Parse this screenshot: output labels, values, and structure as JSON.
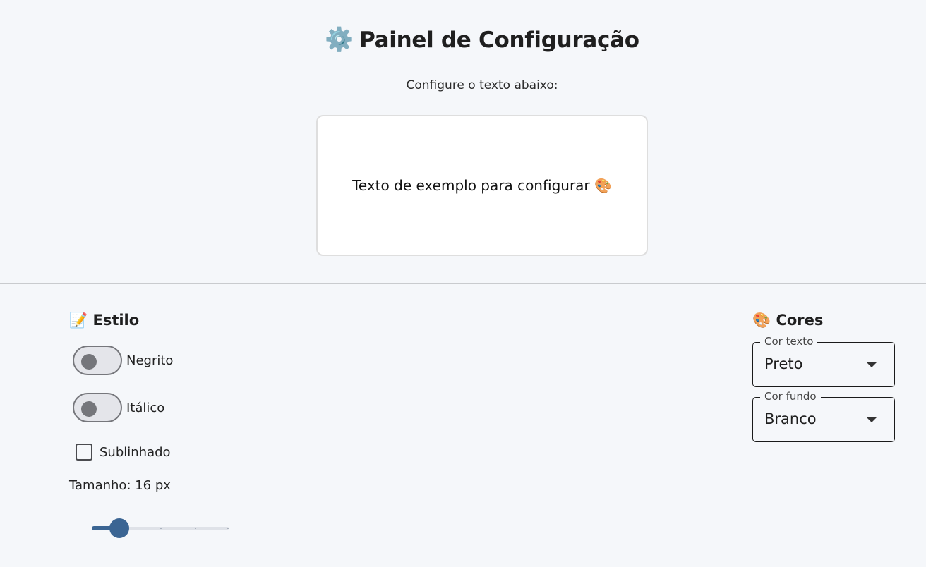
{
  "header": {
    "icon": "gear-icon",
    "icon_glyph": "⚙️",
    "title": "Painel de Configuração",
    "subtitle": "Configure o texto abaixo:"
  },
  "preview": {
    "text": "Texto de exemplo para configurar 🎨"
  },
  "style_section": {
    "icon_glyph": "📝",
    "title": "Estilo",
    "bold_label": "Negrito",
    "bold_on": false,
    "italic_label": "Itálico",
    "italic_on": false,
    "underline_label": "Sublinhado",
    "underline_checked": false,
    "size_label": "Tamanho: 16 px",
    "size_slider": {
      "min": 12,
      "max": 32,
      "value": 16,
      "step_marks": 5
    }
  },
  "colors_section": {
    "icon_glyph": "🎨",
    "title": "Cores",
    "text_color_label": "Cor texto",
    "text_color_value": "Preto",
    "bg_color_label": "Cor fundo",
    "bg_color_value": "Branco"
  },
  "colors": {
    "accent": "#3b6593",
    "background": "#f5f7fa",
    "card": "#ffffff"
  }
}
